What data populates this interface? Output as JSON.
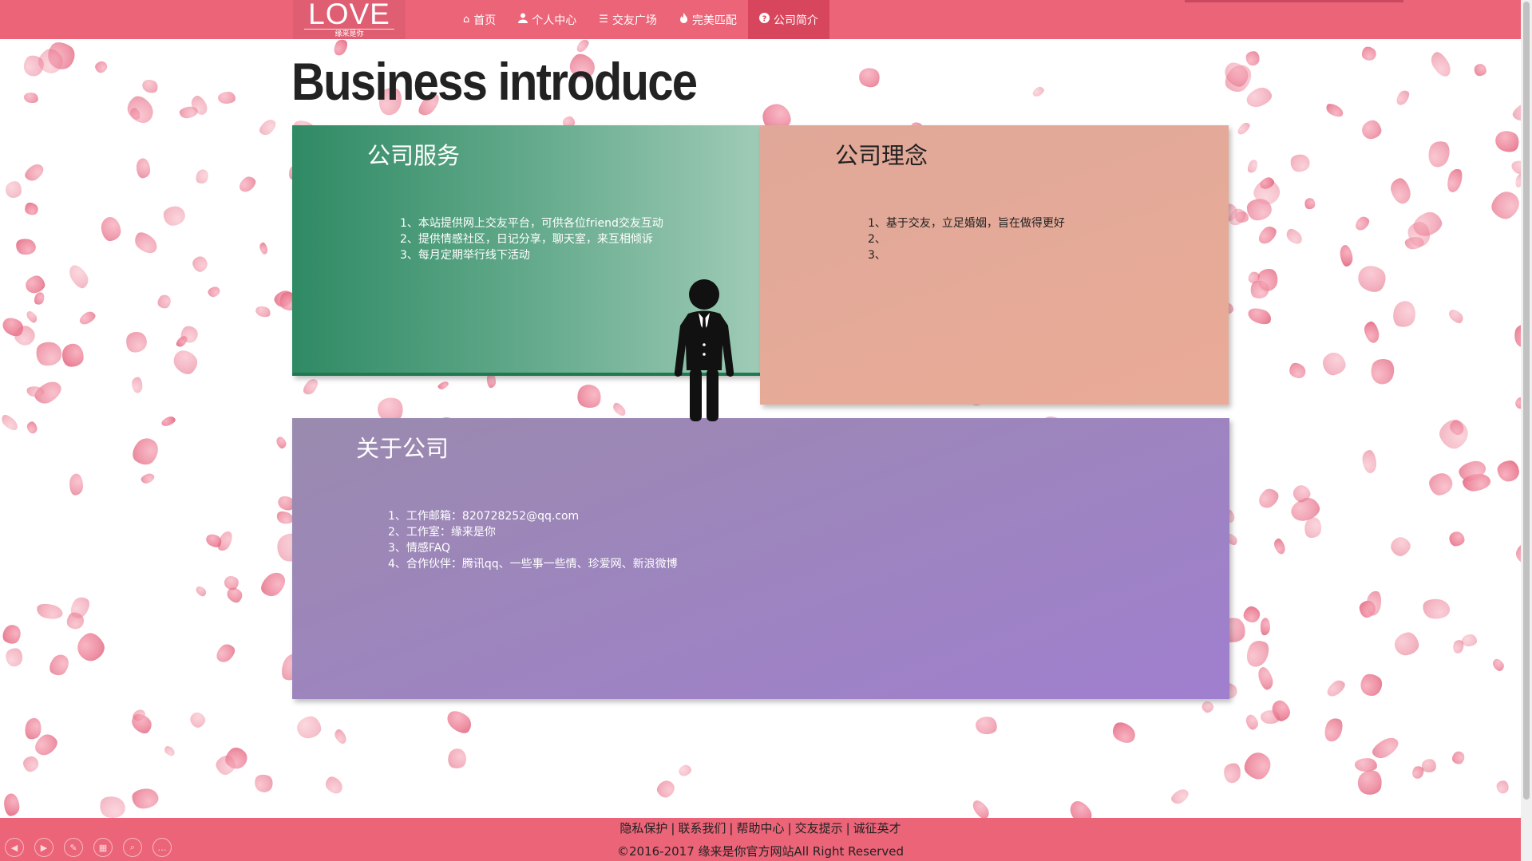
{
  "logo": {
    "word": "LOVE",
    "tagline": "缘来是你"
  },
  "nav": {
    "items": [
      {
        "label": "首页",
        "icon": "home-icon",
        "glyph": "⌂",
        "active": false
      },
      {
        "label": "个人中心",
        "icon": "user-icon",
        "glyph": "👤",
        "active": false
      },
      {
        "label": "交友广场",
        "icon": "list-icon",
        "glyph": "☰",
        "active": false
      },
      {
        "label": "完美匹配",
        "icon": "flame-icon",
        "glyph": "♨",
        "active": false
      },
      {
        "label": "公司简介",
        "icon": "question-circle-icon",
        "glyph": "?",
        "active": true
      }
    ]
  },
  "page": {
    "title": "Business introduce"
  },
  "panels": {
    "service": {
      "title": "公司服务",
      "items": [
        "1、本站提供网上交友平台，可供各位friend交友互动",
        "2、提供情感社区，日记分享，聊天室，来互相倾诉",
        "3、每月定期举行线下活动"
      ]
    },
    "idea": {
      "title": "公司理念",
      "items": [
        "1、基于交友，立足婚姻，旨在做得更好",
        "2、",
        "3、"
      ]
    },
    "about": {
      "title": "关于公司",
      "items": [
        "1、工作邮箱：820728252@qq.com",
        "2、工作室：缘来是你",
        "3、情感FAQ",
        "4、合作伙伴：腾讯qq、一些事一些情、珍爱网、新浪微博"
      ]
    }
  },
  "footer": {
    "links": [
      "隐私保护",
      "联系我们",
      "帮助中心",
      "交友提示",
      "诚征英才"
    ],
    "separator": "|",
    "copyright": "©2016-2017 缘来是你官方网站All Right Reserved"
  },
  "controls": [
    {
      "name": "prev-icon",
      "glyph": "◀"
    },
    {
      "name": "next-icon",
      "glyph": "▶"
    },
    {
      "name": "pen-icon",
      "glyph": "✎"
    },
    {
      "name": "slides-icon",
      "glyph": "▦"
    },
    {
      "name": "zoom-icon",
      "glyph": "⌕"
    },
    {
      "name": "more-icon",
      "glyph": "…"
    }
  ],
  "colors": {
    "brand": "#ec6478",
    "nav_active": "#d8465d",
    "service_panel": "#2f8a64",
    "idea_panel": "#e0a898",
    "about_panel": "#a07fcf"
  }
}
